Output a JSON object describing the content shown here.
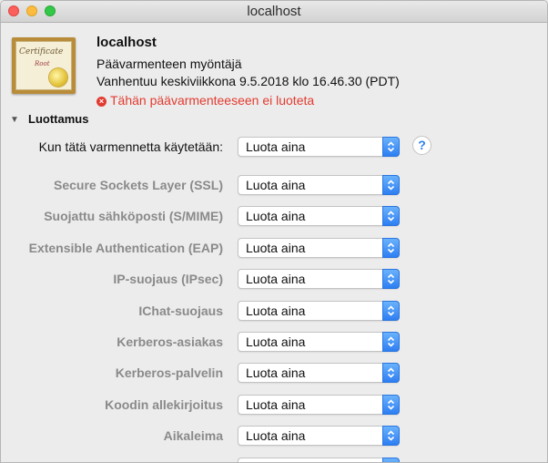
{
  "window": {
    "title": "localhost"
  },
  "certificate": {
    "icon_text": "Certificate",
    "icon_subtext": "Root",
    "name": "localhost",
    "type": "Päävarmenteen myöntäjä",
    "expiry": "Vanhentuu keskiviikkona 9.5.2018 klo 16.46.30 (PDT)",
    "warning": "Tähän päävarmenteeseen ei luoteta"
  },
  "trust": {
    "section_title": "Luottamus",
    "main_label": "Kun tätä varmennetta käytetään:",
    "main_value": "Luota aina",
    "help_symbol": "?",
    "rows": [
      {
        "label": "Secure Sockets Layer (SSL)",
        "value": "Luota aina"
      },
      {
        "label": "Suojattu sähköposti (S/MIME)",
        "value": "Luota aina"
      },
      {
        "label": "Extensible Authentication (EAP)",
        "value": "Luota aina"
      },
      {
        "label": "IP-suojaus (IPsec)",
        "value": "Luota aina"
      },
      {
        "label": "IChat-suojaus",
        "value": "Luota aina"
      },
      {
        "label": "Kerberos-asiakas",
        "value": "Luota aina"
      },
      {
        "label": "Kerberos-palvelin",
        "value": "Luota aina"
      },
      {
        "label": "Koodin allekirjoitus",
        "value": "Luota aina"
      },
      {
        "label": "Aikaleima",
        "value": "Luota aina"
      },
      {
        "label": "",
        "value": ""
      }
    ]
  },
  "colors": {
    "accent": "#2d7ef2",
    "warning": "#e23b30"
  }
}
